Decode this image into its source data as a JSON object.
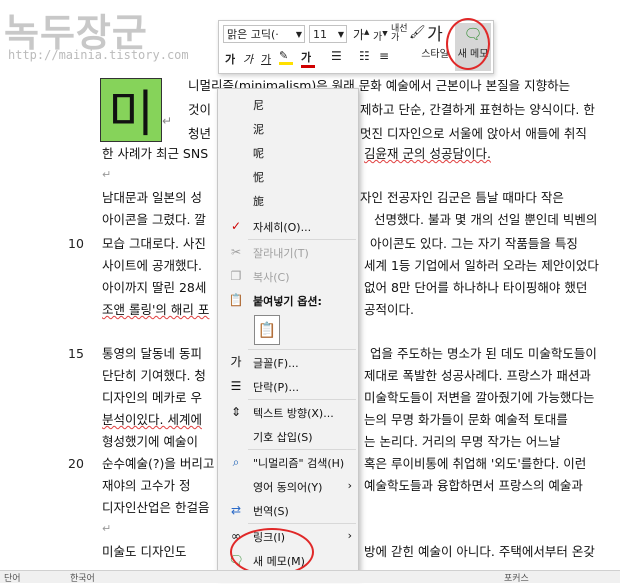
{
  "watermark": {
    "title": "녹두장군",
    "url": "http://mainia.tistory.com"
  },
  "dropcap": {
    "char": "미"
  },
  "line_numbers": [
    "10",
    "15",
    "20"
  ],
  "paragraph_mark": "↵",
  "doc_lines": [
    "니멀리즘(minimalism)은 원래 문화 예술에서 근본이나 본질을 지향하는",
    "것이",
    "제하고 단순, 간결하게 표현하는 양식이다. 한",
    "청년",
    "멋진 디자인으로 서울에 앉아서 애들에 취직",
    "한 사례가 최근 SNS",
    "김윤재 군의 성공담이다.",
    "남대문과 일본의 성",
    "자인 전공자인 김군은 틈날 때마다 작은",
    "아이콘을 그렸다. 깔",
    "선명했다. 불과 몇 개의 선일 뿐인데 빅벤의",
    "모습 그대로다. 사진",
    "아이콘도 있다. 그는 자기 작품들을 특징",
    "사이트에 공개했다.",
    "세계 1등 기업에서 일하러 오라는 제안이었다",
    "아이까지 딸린 28세",
    "없어 8만 단어를 하나하나 타이핑해야 했던",
    "조앤 롤링'의 해리 포",
    "공적이다.",
    "통영의 달동네 동피",
    "업을 주도하는 명소가 된 데도 미술학도들이",
    "단단히 기여했다. 청",
    "제대로 폭발한 성공사례다. 프랑스가 패션과",
    "디자인의 메카로 우",
    "미술학도들이 저변을 깔아줬기에 가능했다는",
    "분석이있다. 세계에",
    "는의 무명 화가들이 문화 예술적 토대를",
    "형성했기에 예술이",
    "는 논리다. 거리의 무명 작가는 어느날",
    "순수예술(?)을 버리고",
    "혹은 루이비통에 취업해 '외도'를한다. 이런",
    "재야의 고수가 정",
    "예술학도들과 융합하면서 프랑스의 예술과",
    "디자인산업은 한걸음",
    "미술도 디자인도",
    "방에 갇힌 예술이 아니다. 주택에서부터 온갖"
  ],
  "mini_toolbar": {
    "font_name": "맑은 고딕(·",
    "font_size": "11",
    "grow_font": "가",
    "shrink_font": "가",
    "bold": "가",
    "italic": "가",
    "underline": "가",
    "font_color": "가",
    "styles_label": "스타일",
    "new_memo_label": "새 메모",
    "highlight_color": "#ffe000",
    "font_color_value": "#d00000"
  },
  "context_menu": {
    "candidates": [
      "尼",
      "泥",
      "呢",
      "怩",
      "旎"
    ],
    "items": [
      {
        "icon": "details-icon",
        "label": "자세히(O)...",
        "enabled": true
      },
      {
        "icon": "cut-icon",
        "label": "잘라내기(T)",
        "enabled": false
      },
      {
        "icon": "copy-icon",
        "label": "복사(C)",
        "enabled": false
      },
      {
        "icon": "paste-icon",
        "label": "붙여넣기 옵션:",
        "enabled": true
      },
      {
        "icon": "font-icon",
        "label": "글꼴(F)...",
        "enabled": true
      },
      {
        "icon": "paragraph-icon",
        "label": "단락(P)...",
        "enabled": true
      },
      {
        "icon": "text-direction-icon",
        "label": "텍스트 방향(X)...",
        "enabled": true
      },
      {
        "icon": "",
        "label": "기호 삽입(S)",
        "enabled": true
      },
      {
        "icon": "search-icon",
        "label": "\"니멀리즘\" 검색(H)",
        "enabled": true
      },
      {
        "icon": "",
        "label": "영어 동의어(Y)",
        "enabled": true
      },
      {
        "icon": "translate-icon",
        "label": "번역(S)",
        "enabled": true
      },
      {
        "icon": "link-icon",
        "label": "링크(I)",
        "enabled": true
      },
      {
        "icon": "new-memo-icon",
        "label": "새 메모(M)",
        "enabled": true
      }
    ]
  },
  "status_bar": {
    "left": "단어",
    "lang": "한국어",
    "right": "포커스"
  }
}
